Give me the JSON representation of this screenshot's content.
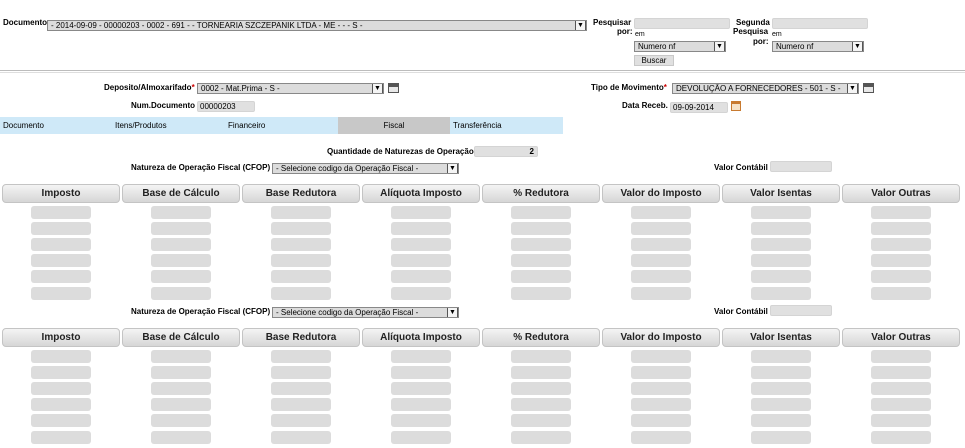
{
  "documento": {
    "label": "Documento",
    "value": "- 2014-09-09 - 00000203 - 0002 - 691 - - TORNEARIA SZCZEPANIK LTDA - ME - - - S -"
  },
  "pesquisar": {
    "label": "Pesquisar por:",
    "em": "em",
    "select": "Numero nf",
    "button": "Buscar"
  },
  "segunda": {
    "label": "Segunda Pesquisa por:",
    "em": "em",
    "select": "Numero nf"
  },
  "deposito": {
    "label": "Deposito/Almoxarifado",
    "value": "0002 - Mat.Prima - S -"
  },
  "num_documento": {
    "label": "Num.Documento",
    "value": "00000203"
  },
  "tipo_movimento": {
    "label": "Tipo de Movimento",
    "value": "DEVOLUÇÃO A FORNECEDORES - 501 - S -"
  },
  "data_receb": {
    "label": "Data Receb.",
    "value": "09-09-2014"
  },
  "tabs": [
    "Documento",
    "Itens/Produtos",
    "Financeiro",
    "Fiscal",
    "Transferência"
  ],
  "active_tab": "Fiscal",
  "qtd_naturezas": {
    "label": "Quantidade de Naturezas de Operação",
    "value": "2"
  },
  "cfop": {
    "label": "Natureza de Operação Fiscal (CFOP)",
    "placeholder": "- Selecione codigo da Operação Fiscal -"
  },
  "valor_contabil": {
    "label": "Valor Contábil"
  },
  "columns": [
    "Imposto",
    "Base de Cálculo",
    "Base Redutora",
    "Alíquota Imposto",
    "% Redutora",
    "Valor do Imposto",
    "Valor Isentas",
    "Valor Outras"
  ],
  "colors": {
    "tab_bar": "#cfe9f8",
    "active_tab": "#c8c8c8",
    "field": "#dcdcdc",
    "required": "#cc0000"
  }
}
